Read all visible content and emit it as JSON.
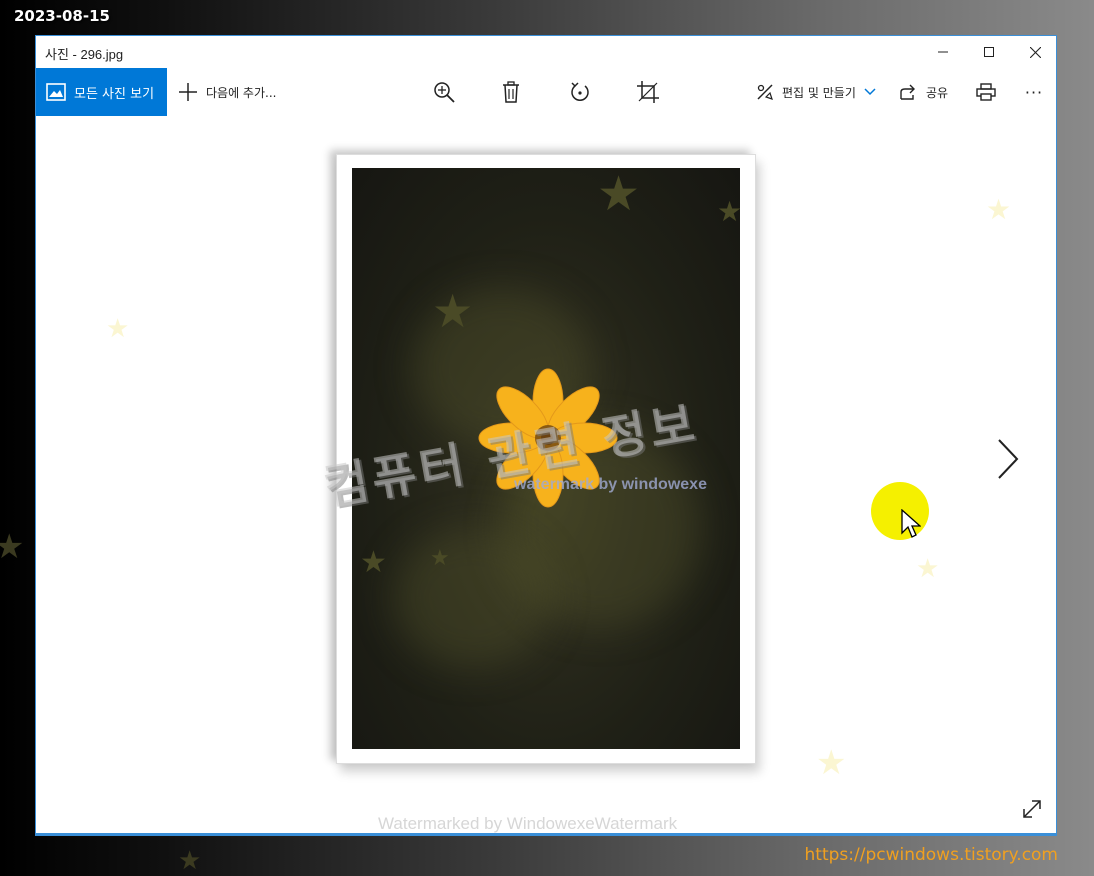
{
  "overlay": {
    "date": "2023-08-15",
    "url": "https://pcwindows.tistory.com"
  },
  "window": {
    "title": "사진 - 296.jpg",
    "controls": {
      "minimize_icon": "minimize-icon",
      "maximize_icon": "maximize-icon",
      "close_icon": "close-icon"
    }
  },
  "toolbar": {
    "all_photos_label": "모든 사진 보기",
    "add_to_label": "다음에 추가...",
    "edit_create_label": "편집 및 만들기",
    "share_label": "공유",
    "more_label": "···",
    "icons": [
      "photos-icon",
      "plus-icon",
      "zoom-in-icon",
      "delete-icon",
      "rotate-icon",
      "crop-icon",
      "edit-icon",
      "chevron-down-icon",
      "share-icon",
      "print-icon",
      "more-icon"
    ]
  },
  "viewer": {
    "watermark_title": "컴퓨터 관련 정보",
    "watermark_small": "watermark by windowexe",
    "watermark_bottom": "Watermarked by WindowexeWatermark",
    "next_icon": "chevron-right-icon",
    "fullscreen_icon": "expand-icon"
  },
  "colors": {
    "accent": "#0078d7",
    "url_text": "#f0a020",
    "cursor_highlight": "#f5f000"
  }
}
